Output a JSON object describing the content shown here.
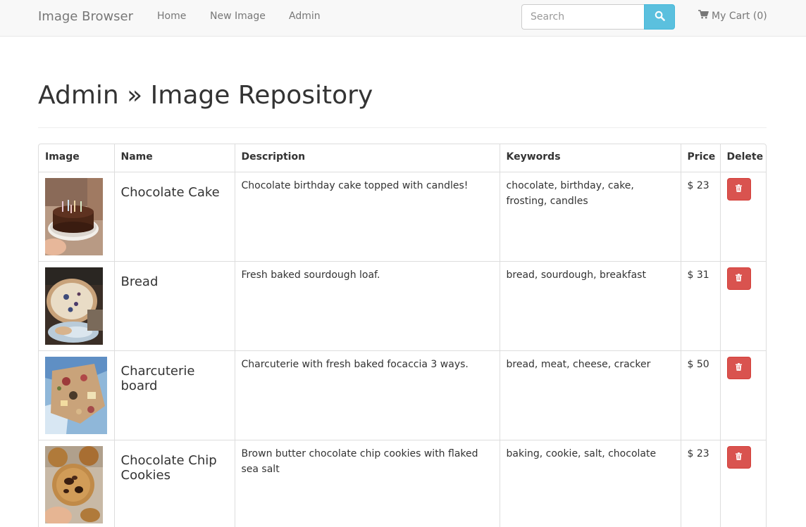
{
  "navbar": {
    "brand": "Image Browser",
    "links": [
      "Home",
      "New Image",
      "Admin"
    ],
    "search_placeholder": "Search",
    "search_icon": "search-icon",
    "cart_icon": "shopping-cart-icon",
    "cart_label": "My Cart (0)"
  },
  "header": {
    "title": "Admin » Image Repository"
  },
  "table": {
    "columns": [
      "Image",
      "Name",
      "Description",
      "Keywords",
      "Price",
      "Delete"
    ],
    "rows": [
      {
        "name": "Chocolate Cake",
        "description": "Chocolate birthday cake topped with candles!",
        "keywords": "chocolate, birthday, cake, frosting, candles",
        "price": "$ 23",
        "image": "chocolate-cake-photo",
        "delete_icon": "trash-icon"
      },
      {
        "name": "Bread",
        "description": "Fresh baked sourdough loaf.",
        "keywords": "bread, sourdough, breakfast",
        "price": "$ 31",
        "image": "sourdough-bread-photo",
        "delete_icon": "trash-icon"
      },
      {
        "name": "Charcuterie board",
        "description": "Charcuterie with fresh baked focaccia 3 ways.",
        "keywords": "bread, meat, cheese, cracker",
        "price": "$ 50",
        "image": "charcuterie-board-photo",
        "delete_icon": "trash-icon"
      },
      {
        "name": "Chocolate Chip Cookies",
        "description": "Brown butter chocolate chip cookies with flaked sea salt",
        "keywords": "baking, cookie, salt, chocolate",
        "price": "$ 23",
        "image": "cookies-photo",
        "delete_icon": "trash-icon"
      }
    ]
  },
  "colors": {
    "navbar_bg": "#f8f8f8",
    "search_button": "#5bc0de",
    "delete_button": "#d9534f",
    "text": "#333333",
    "muted": "#777777"
  }
}
